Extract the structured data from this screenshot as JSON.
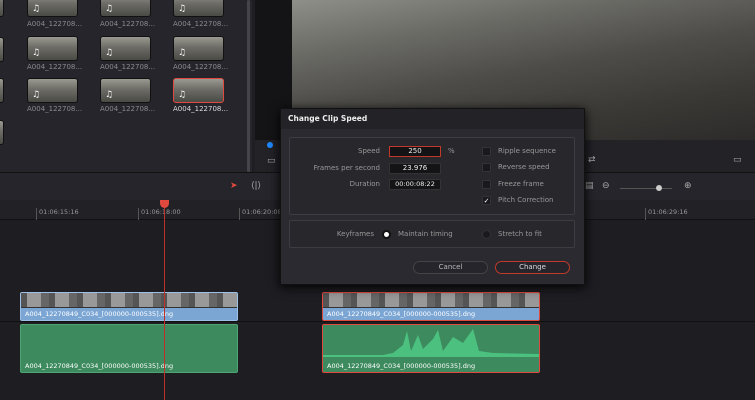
{
  "media_pool": {
    "clips": [
      {
        "label": "A004_122708...",
        "selected": false
      },
      {
        "label": "A004_122708...",
        "selected": false
      },
      {
        "label": "A004_122708...",
        "selected": false
      },
      {
        "label": "A004_122708...",
        "selected": false
      },
      {
        "label": "A004_122708...",
        "selected": false
      },
      {
        "label": "A004_122708...",
        "selected": false
      },
      {
        "label": "A004_122708...",
        "selected": false
      },
      {
        "label": "A004_122708...",
        "selected": false
      },
      {
        "label": "A004_122708...",
        "selected": true
      }
    ],
    "clip_icon": "music-note-icon"
  },
  "timeline": {
    "ruler": [
      "01:06:15:16",
      "01:06:18:00",
      "01:06:20:08",
      "01:06:29:16"
    ],
    "clips": [
      {
        "video_name": "A004_12270849_C034_[000000-000535].dng",
        "audio_name": "A004_12270849_C034_[000000-000535].dng",
        "selected": false
      },
      {
        "video_name": "A004_12270849_C034_[000000-000535].dng",
        "audio_name": "A004_12270849_C034_[000000-000535].dng",
        "selected": true
      }
    ],
    "accent": "#e0493d"
  },
  "dialog": {
    "title": "Change Clip Speed",
    "speed_label": "Speed",
    "speed_value": "250",
    "speed_unit": "%",
    "fps_label": "Frames per second",
    "fps_value": "23.976",
    "duration_label": "Duration",
    "duration_value": "00:00:08:22",
    "options": [
      {
        "label": "Ripple sequence",
        "checked": false
      },
      {
        "label": "Reverse speed",
        "checked": false
      },
      {
        "label": "Freeze frame",
        "checked": false
      },
      {
        "label": "Pitch Correction",
        "checked": true
      }
    ],
    "keyframes_label": "Keyframes",
    "keyframe_options": [
      {
        "label": "Maintain timing",
        "selected": true
      },
      {
        "label": "Stretch to fit",
        "selected": false
      }
    ],
    "cancel_label": "Cancel",
    "change_label": "Change",
    "check_mark": "✓"
  }
}
